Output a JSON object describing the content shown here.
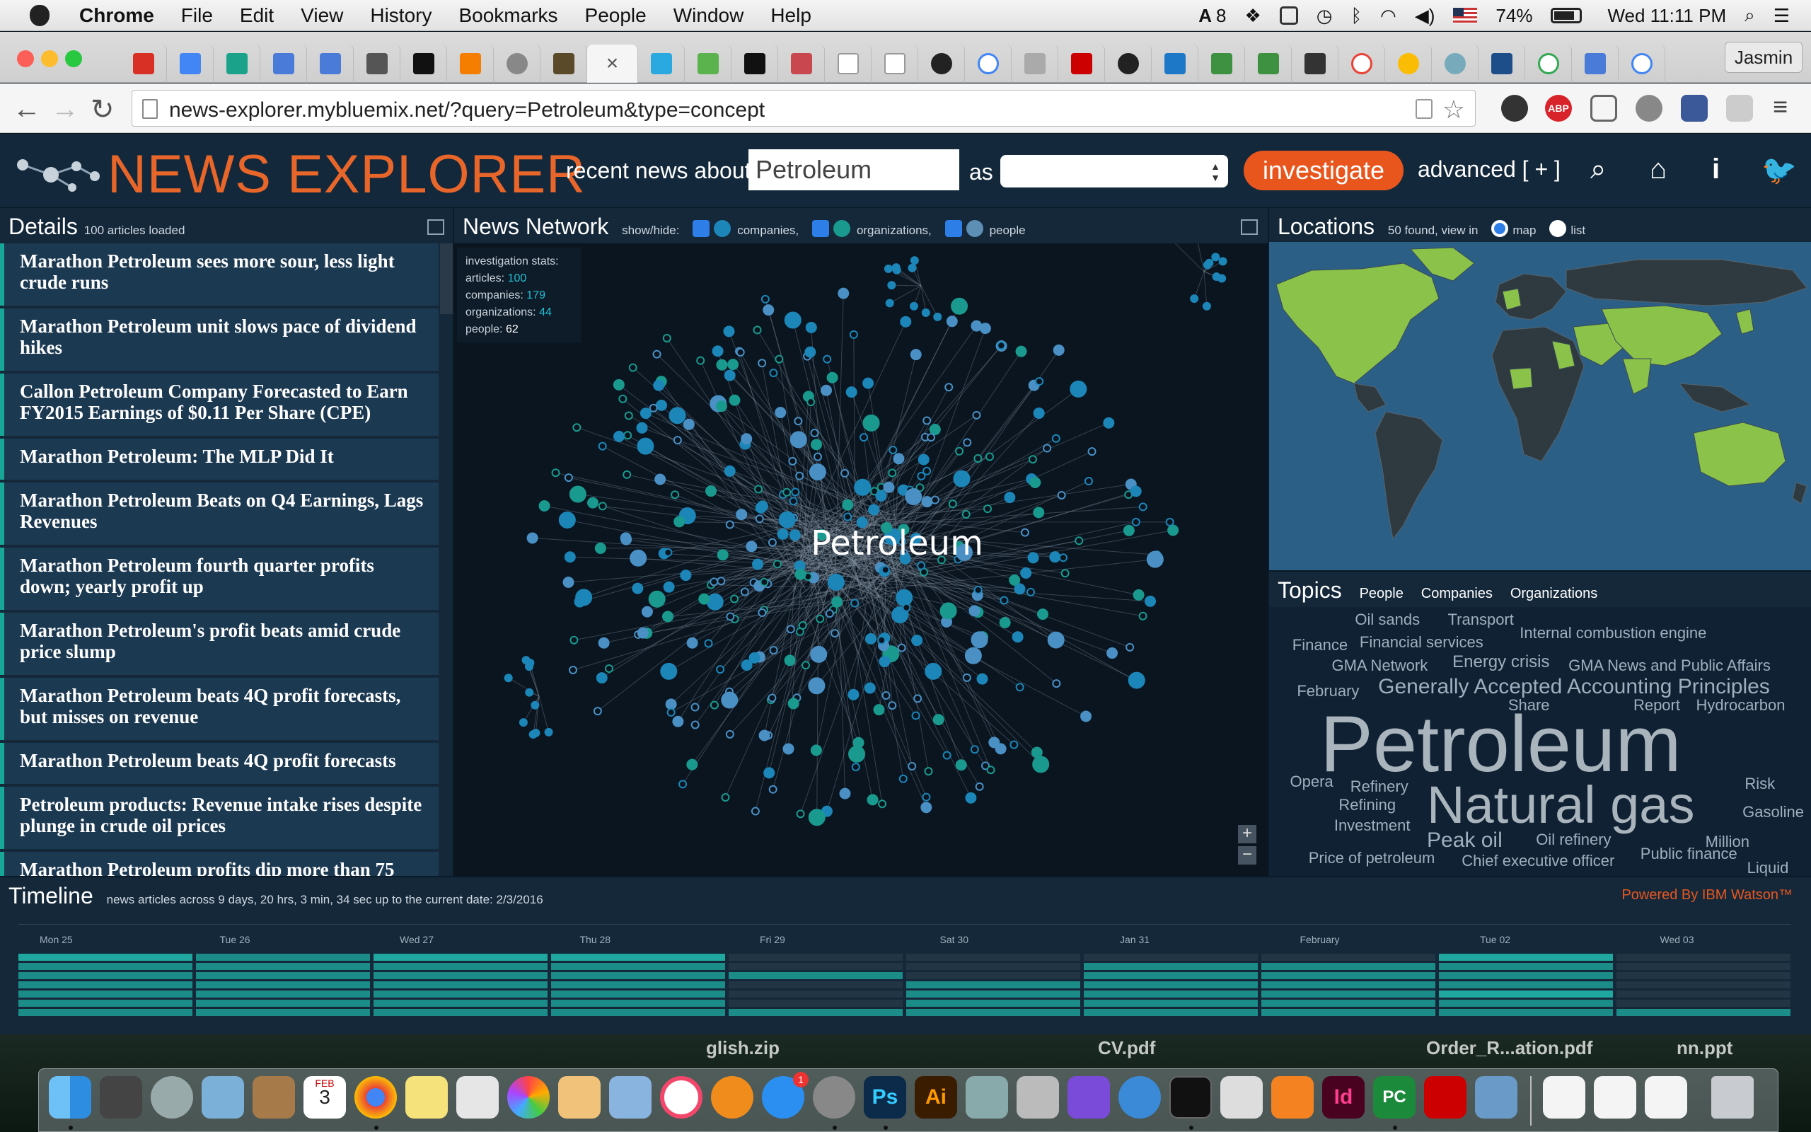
{
  "menubar": {
    "items": [
      "Chrome",
      "File",
      "Edit",
      "View",
      "History",
      "Bookmarks",
      "People",
      "Window",
      "Help"
    ],
    "badge_count": "8",
    "battery": "74%",
    "clock": "Wed 11:11 PM"
  },
  "browser": {
    "profile": "Jasmin",
    "url": "news-explorer.mybluemix.net/?query=Petroleum&type=concept",
    "active_tab_close": "×",
    "ext_abp": "ABP"
  },
  "app": {
    "brand": "NEWS EXPLORER",
    "recent_label": "recent news about",
    "query": "Petroleum",
    "as_label": "as",
    "investigate": "investigate",
    "advanced": "advanced [ + ]"
  },
  "details": {
    "title": "Details",
    "count": "100 articles loaded",
    "articles": [
      "Marathon Petroleum sees more sour, less light crude runs",
      "Marathon Petroleum unit slows pace of dividend hikes",
      "Callon Petroleum Company Forecasted to Earn FY2015 Earnings of $0.11 Per Share (CPE)",
      "Marathon Petroleum: The MLP Did It",
      "Marathon Petroleum Beats on Q4 Earnings, Lags Revenues",
      "Marathon Petroleum fourth quarter profits down; yearly profit up",
      "Marathon Petroleum's profit beats amid crude price slump",
      "Marathon Petroleum beats 4Q profit forecasts, but misses on revenue",
      "Marathon Petroleum beats 4Q profit forecasts",
      "Petroleum products: Revenue intake rises despite plunge in crude oil prices",
      "Marathon Petroleum profits dip more than 75"
    ]
  },
  "network": {
    "title": "News Network",
    "showhide": "show/hide:",
    "f_companies": "companies,",
    "f_organizations": "organizations,",
    "f_people": "people",
    "center_label": "Petroleum",
    "stats": {
      "heading": "investigation stats:",
      "articles_label": "articles:",
      "articles": "100",
      "companies_label": "companies:",
      "companies": "179",
      "organizations_label": "organizations:",
      "organizations": "44",
      "people_label": "people:",
      "people": "62"
    },
    "zoom_in": "+",
    "zoom_out": "−"
  },
  "locations": {
    "title": "Locations",
    "found": "50 found, view in",
    "opt_map": "map",
    "opt_list": "list"
  },
  "topics": {
    "title": "Topics",
    "tabs": [
      "People",
      "Companies",
      "Organizations"
    ],
    "words": [
      "Oil sands",
      "Transport",
      "Finance",
      "Financial services",
      "Internal combustion engine",
      "GMA Network",
      "Energy crisis",
      "GMA News and Public Affairs",
      "February",
      "Generally Accepted Accounting Principles",
      "Share",
      "Report",
      "Hydrocarbon",
      "Petroleum",
      "Opera",
      "Refinery",
      "Risk",
      "Refining",
      "Natural gas",
      "Gasoline",
      "Investment",
      "Peak oil",
      "Oil refinery",
      "Million",
      "Price of petroleum",
      "Chief executive officer",
      "Public finance",
      "Liquid"
    ]
  },
  "timeline": {
    "title": "Timeline",
    "summary": "news articles across 9 days, 20 hrs, 3 min, 34 sec up to the current date: 2/3/2016",
    "powered": "Powered By IBM Watson™",
    "dates": [
      "Mon 25",
      "Tue 26",
      "Wed 27",
      "Thu 28",
      "Fri 29",
      "Sat 30",
      "Jan 31",
      "February",
      "Tue 02",
      "Wed 03"
    ]
  },
  "desktop": {
    "files": [
      "glish.zip",
      "CV.pdf",
      "Order_R...ation.pdf",
      "nn.ppt"
    ]
  },
  "dock": {
    "calendar_month": "FEB",
    "calendar_day": "3",
    "appstore_badge": "1",
    "ps": "Ps",
    "ai": "Ai",
    "id": "Id",
    "pc": "PC"
  },
  "colors": {
    "brand": "#e8662a",
    "accent_teal": "#18a796",
    "investigate": "#e8561e",
    "panel": "#14283a",
    "map_land": "#8bc34a"
  }
}
